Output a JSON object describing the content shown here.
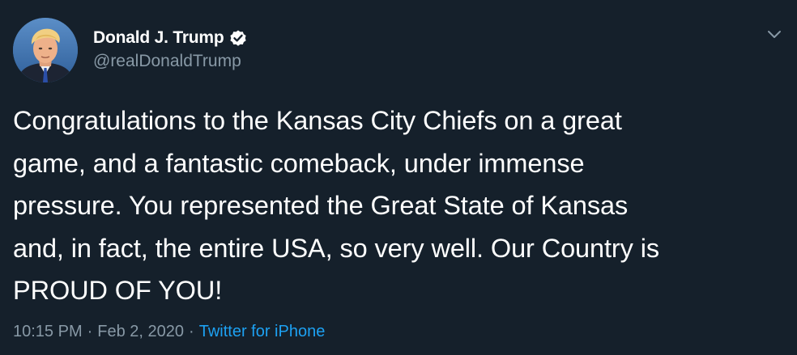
{
  "tweet": {
    "display_name": "Donald J. Trump",
    "handle": "@realDonaldTrump",
    "verified": true,
    "text": "Congratulations to the Kansas City Chiefs on a great\ngame, and a fantastic comeback, under immense\npressure. You represented the Great State of Kansas\nand, in fact, the entire USA, so very well. Our Country is\nPROUD OF YOU!",
    "time": "10:15 PM",
    "separator": "·",
    "date": "Feb 2, 2020",
    "source": "Twitter for iPhone"
  },
  "icons": {
    "verified": "verified-badge-icon",
    "menu": "chevron-down-icon"
  },
  "colors": {
    "background": "#15202b",
    "text": "#ffffff",
    "secondary": "#8899a6",
    "accent": "#1da1f2"
  }
}
